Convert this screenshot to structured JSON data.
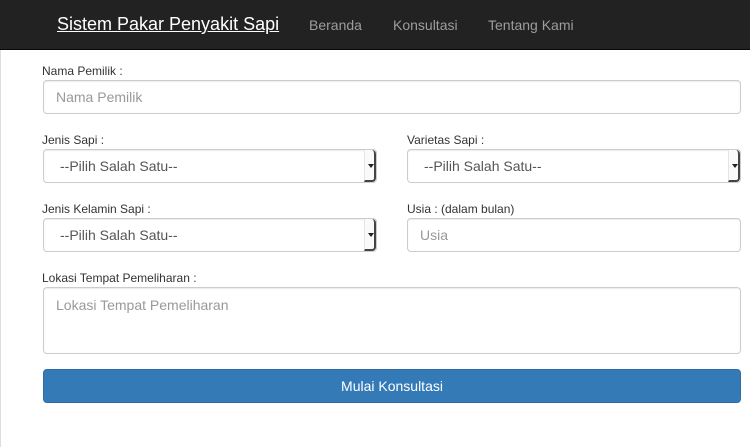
{
  "navbar": {
    "brand": "Sistem Pakar Penyakit Sapi",
    "links": [
      "Beranda",
      "Konsultasi",
      "Tentang Kami"
    ]
  },
  "form": {
    "owner_name": {
      "label": "Nama Pemilik :",
      "placeholder": "Nama Pemilik",
      "value": ""
    },
    "cow_type": {
      "label": "Jenis Sapi :",
      "selected": "--Pilih Salah Satu--"
    },
    "variety": {
      "label": "Varietas Sapi :",
      "selected": "--Pilih Salah Satu--"
    },
    "sex": {
      "label": "Jenis Kelamin Sapi :",
      "selected": "--Pilih Salah Satu--"
    },
    "age": {
      "label": "Usia : (dalam bulan)",
      "placeholder": "Usia",
      "value": ""
    },
    "location": {
      "label": "Lokasi Tempat Pemeliharan :",
      "placeholder": "Lokasi Tempat Pemeliharan",
      "value": ""
    },
    "submit_label": "Mulai Konsultasi"
  },
  "colors": {
    "navbar_bg": "#222222",
    "nav_link": "#9d9d9d",
    "primary": "#337ab7"
  }
}
